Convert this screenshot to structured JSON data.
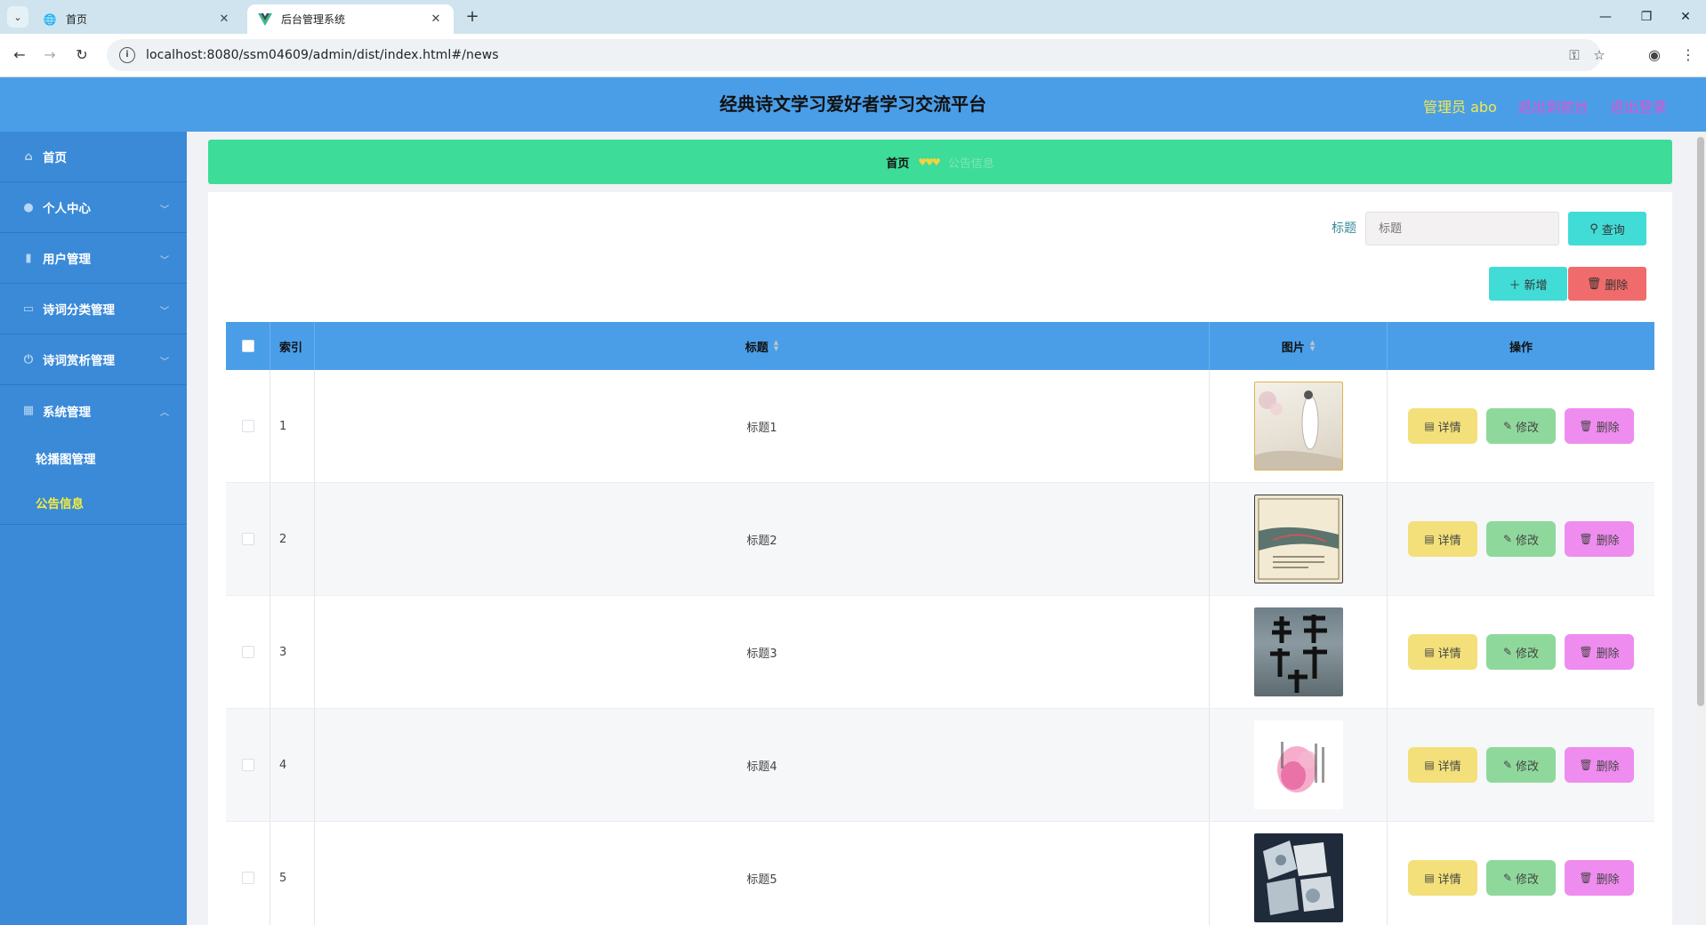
{
  "browser": {
    "tabs": [
      {
        "title": "首页",
        "active": false
      },
      {
        "title": "后台管理系统",
        "active": true
      }
    ],
    "url": "localhost:8080/ssm04609/admin/dist/index.html#/news"
  },
  "header": {
    "title": "经典诗文学习爱好者学习交流平台",
    "user": "管理员 abo",
    "to_front": "退出到前台",
    "logout": "退出登录"
  },
  "sidebar": {
    "items": [
      {
        "label": "首页",
        "icon": "home-icon"
      },
      {
        "label": "个人中心",
        "icon": "user-icon"
      },
      {
        "label": "用户管理",
        "icon": "bar-chart-icon"
      },
      {
        "label": "诗词分类管理",
        "icon": "card-icon"
      },
      {
        "label": "诗词赏析管理",
        "icon": "power-icon"
      },
      {
        "label": "系统管理",
        "icon": "grid-icon"
      }
    ],
    "submenu": [
      {
        "label": "轮播图管理",
        "active": false
      },
      {
        "label": "公告信息",
        "active": true
      }
    ]
  },
  "breadcrumb": {
    "home": "首页",
    "current": "公告信息"
  },
  "search": {
    "label": "标题",
    "placeholder": "标题",
    "query_btn": "查询"
  },
  "actions": {
    "add": "新增",
    "delete": "删除"
  },
  "table": {
    "headers": {
      "index": "索引",
      "title": "标题",
      "image": "图片",
      "ops": "操作"
    },
    "rows": [
      {
        "index": "1",
        "title": "标题1"
      },
      {
        "index": "2",
        "title": "标题2"
      },
      {
        "index": "3",
        "title": "标题3"
      },
      {
        "index": "4",
        "title": "标题4"
      },
      {
        "index": "5",
        "title": "标题5"
      }
    ],
    "op_labels": {
      "detail": "详情",
      "edit": "修改",
      "delete": "删除"
    }
  },
  "colors": {
    "header_bg": "#4a9ee8",
    "sidebar_bg": "#3a8ad8",
    "breadcrumb_bg": "#3ddc98",
    "query_btn": "#41dcd6",
    "add_btn": "#41dcd6",
    "delete_btn": "#f06b6b"
  }
}
